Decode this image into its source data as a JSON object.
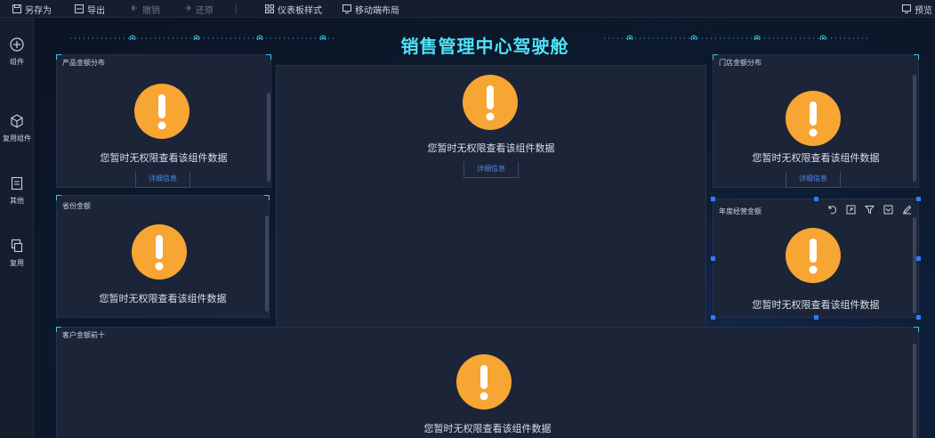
{
  "toolbar": {
    "save_as": "另存为",
    "export": "导出",
    "undo": "撤销",
    "redo": "还原",
    "dashboard_style": "仪表板样式",
    "mobile_layout": "移动端布局",
    "preview": "预览"
  },
  "sidebar": {
    "items": [
      {
        "label": "组件",
        "icon": "plus-circle-icon"
      },
      {
        "label": "复用组件",
        "icon": "cube-icon"
      },
      {
        "label": "其他",
        "icon": "document-icon"
      },
      {
        "label": "复用",
        "icon": "copy-icon"
      }
    ]
  },
  "canvas": {
    "title": "销售管理中心驾驶舱",
    "accent": "#4fe3f7"
  },
  "cards": [
    {
      "title": "产品金额分布",
      "message": "您暂时无权限查看该组件数据",
      "detail": "详细信息"
    },
    {
      "title": "",
      "message": "您暂时无权限查看该组件数据",
      "detail": "详细信息"
    },
    {
      "title": "门店金额分布",
      "message": "您暂时无权限查看该组件数据",
      "detail": "详细信息"
    },
    {
      "title": "省份金额",
      "message": "您暂时无权限查看该组件数据",
      "detail": ""
    },
    {
      "title": "年度经营金额",
      "message": "您暂时无权限查看该组件数据",
      "detail": ""
    },
    {
      "title": "客户金额前十",
      "message": "您暂时无权限查看该组件数据",
      "detail": ""
    }
  ],
  "card_tools": [
    "undo-icon",
    "expand-icon",
    "filter-icon",
    "collapse-icon",
    "edit-icon"
  ],
  "colors": {
    "warning": "#f7a533",
    "link": "#4f86e6",
    "selection": "#2f7cff"
  }
}
